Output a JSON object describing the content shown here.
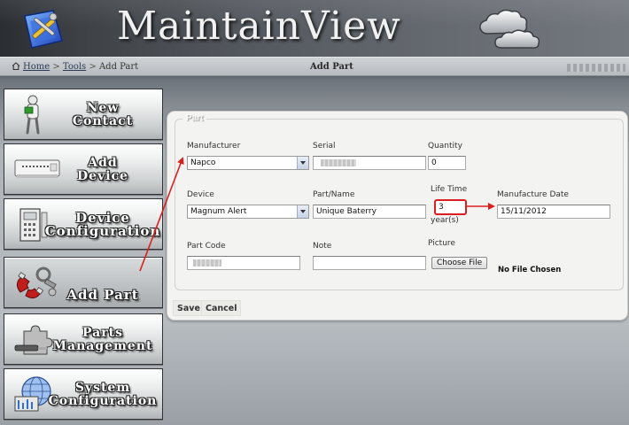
{
  "app": {
    "title": "MaintainView"
  },
  "breadcrumb": {
    "home": "Home",
    "sep1": ">",
    "tools": "Tools",
    "sep2": ">",
    "current": "Add Part"
  },
  "page_heading": "Add Part",
  "sidebar": {
    "items": [
      {
        "label_line1": "New",
        "label_line2": "Contact",
        "icon": "person-icon"
      },
      {
        "label_line1": "Add",
        "label_line2": "Device",
        "icon": "panel-device-icon"
      },
      {
        "label_line1": "Device",
        "label_line2": "Configuration",
        "icon": "keypad-icon"
      },
      {
        "label_line1": "Add Part",
        "label_line2": "",
        "icon": "magnet-parts-icon"
      },
      {
        "label_line1": "Parts",
        "label_line2": "Management",
        "icon": "puzzle-tools-icon"
      },
      {
        "label_line1": "System",
        "label_line2": "Configuration",
        "icon": "globe-settings-icon"
      }
    ]
  },
  "form": {
    "legend": "Part",
    "manufacturer": {
      "label": "Manufacturer",
      "value": "Napco"
    },
    "serial": {
      "label": "Serial"
    },
    "quantity": {
      "label": "Quantity",
      "value": "0"
    },
    "device": {
      "label": "Device",
      "value": "Magnum Alert"
    },
    "part_name": {
      "label": "Part/Name",
      "value": "Unique Baterry"
    },
    "life_time": {
      "label": "Life Time",
      "value": "3",
      "unit": "year(s)"
    },
    "manufacture_date": {
      "label": "Manufacture Date",
      "value": "15/11/2012"
    },
    "part_code": {
      "label": "Part Code"
    },
    "note": {
      "label": "Note",
      "value": ""
    },
    "picture": {
      "label": "Picture",
      "button": "Choose File",
      "status": "No File Chosen"
    }
  },
  "actions": {
    "save": "Save",
    "cancel": "Cancel"
  },
  "colors": {
    "annotation": "#d91f1f",
    "header_dark": "#2a2d31",
    "panel_bg": "#f3f3f1"
  }
}
